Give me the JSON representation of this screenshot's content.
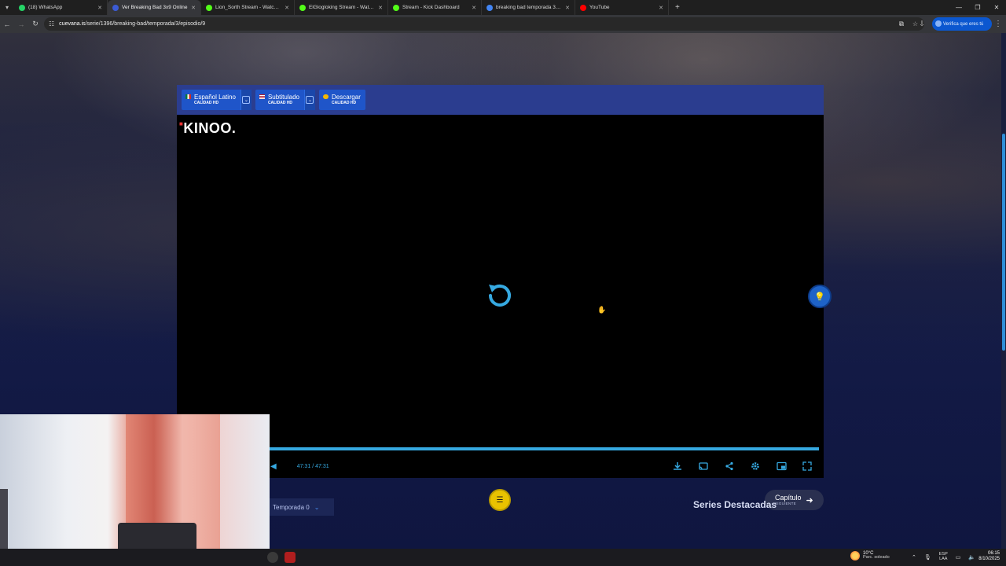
{
  "browser": {
    "tabs": [
      {
        "title": "(18) WhatsApp",
        "favicon_color": "#25d366",
        "active": false
      },
      {
        "title": "Ver Breaking Bad 3x9 Online",
        "favicon_color": "#3b5bd6",
        "active": true
      },
      {
        "title": "Lion_Sorth Stream - Watch Live",
        "favicon_color": "#53fc18",
        "active": false
      },
      {
        "title": "ElGlogloking Stream - Watch Live",
        "favicon_color": "#53fc18",
        "active": false
      },
      {
        "title": "Stream - Kick Dashboard",
        "favicon_color": "#53fc18",
        "active": false
      },
      {
        "title": "breaking bad temporada 3 capitulo",
        "favicon_color": "#4285f4",
        "active": false
      },
      {
        "title": "YouTube",
        "favicon_color": "#ff0000",
        "active": false
      }
    ],
    "url_domain": "cuevana.is",
    "url_path": "/serie/1396/breaking-bad/temporada/3/episodio/9",
    "verify_label": "Verifica que eres tú"
  },
  "player": {
    "sources": [
      {
        "label": "Español Latino",
        "quality": "CALIDAD HD",
        "has_dropdown": true,
        "flag": "mexico-flag-icon"
      },
      {
        "label": "Subtitulado",
        "quality": "CALIDAD HD",
        "has_dropdown": true,
        "flag": "usa-flag-icon"
      },
      {
        "label": "Descargar",
        "quality": "CALIDAD HD",
        "has_dropdown": false,
        "flag": "cloud-download-icon"
      }
    ],
    "logo_text": "KINOO.",
    "time_current": "47:31",
    "time_separator": "/",
    "time_total": "47:31",
    "progress_fraction": 1.0,
    "accent_color": "#36a9e1"
  },
  "page": {
    "next_label": "Capítulo",
    "next_sub": "SIGUIENTE",
    "season_label": "Temporada 0",
    "featured_heading": "Series Destacadas"
  },
  "taskbar": {
    "weather_temp": "10°C",
    "weather_desc": "Parc. soleado",
    "lang_line1": "ESP",
    "lang_line2": "LAA",
    "time": "06:15",
    "date": "8/10/2025"
  }
}
